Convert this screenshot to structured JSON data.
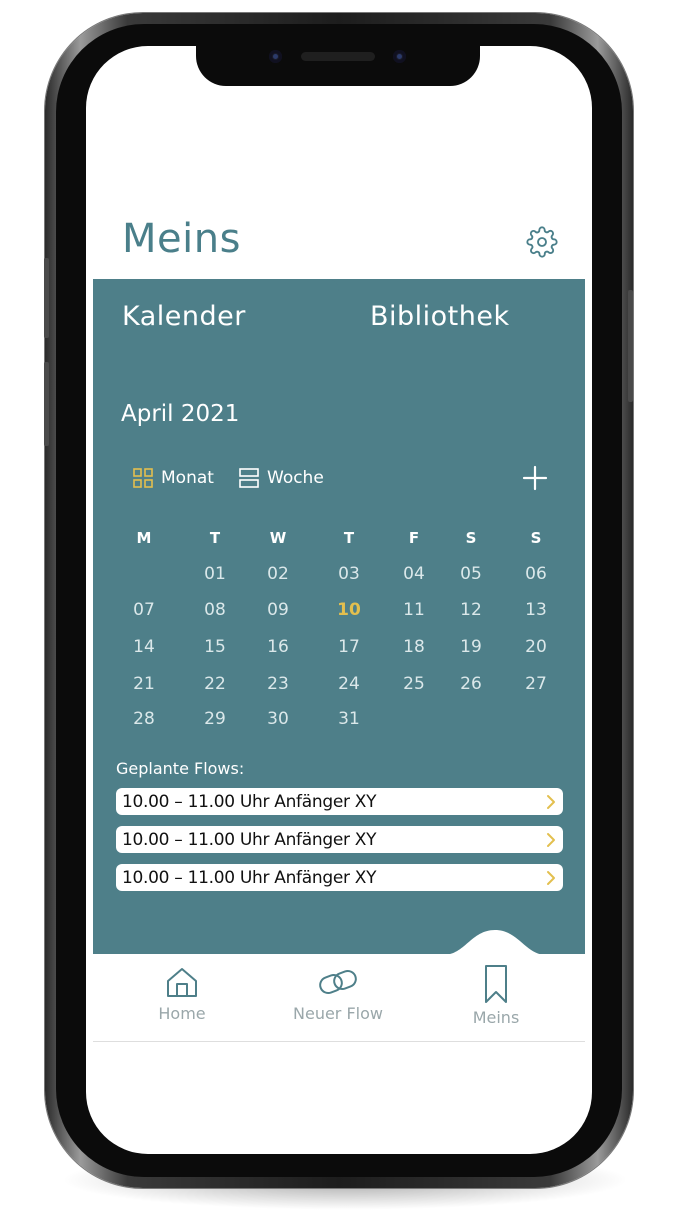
{
  "header": {
    "title": "Meins"
  },
  "tabs": [
    {
      "label": "Kalender",
      "active": true
    },
    {
      "label": "Bibliothek",
      "active": false
    }
  ],
  "calendar": {
    "month_label": "April 2021",
    "views": {
      "month": "Monat",
      "week": "Woche"
    },
    "weekdays": [
      "M",
      "T",
      "W",
      "T",
      "F",
      "S",
      "S"
    ],
    "weeks": [
      [
        "",
        "01",
        "02",
        "03",
        "04",
        "05",
        "06"
      ],
      [
        "07",
        "08",
        "09",
        "10",
        "11",
        "12",
        "13"
      ],
      [
        "14",
        "15",
        "16",
        "17",
        "18",
        "19",
        "20"
      ],
      [
        "21",
        "22",
        "23",
        "24",
        "25",
        "26",
        "27"
      ],
      [
        "28",
        "29",
        "30",
        "31",
        "",
        "",
        ""
      ]
    ],
    "today": "10"
  },
  "planned": {
    "label": "Geplante Flows:",
    "items": [
      "10.00 – 11.00 Uhr Anfänger XY",
      "10.00 – 11.00 Uhr Anfänger XY",
      "10.00 – 11.00 Uhr Anfänger XY"
    ]
  },
  "bottom_nav": [
    {
      "label": "Home",
      "icon": "home-icon"
    },
    {
      "label": "Neuer Flow",
      "icon": "link-icon"
    },
    {
      "label": "Meins",
      "icon": "bookmark-icon",
      "active": true
    }
  ],
  "colors": {
    "accent": "#4e7f89",
    "tab_inactive": "#c3dade",
    "highlight": "#e3bf4e",
    "title": "#4a7f8a",
    "nav_text": "#9aa7aa"
  }
}
